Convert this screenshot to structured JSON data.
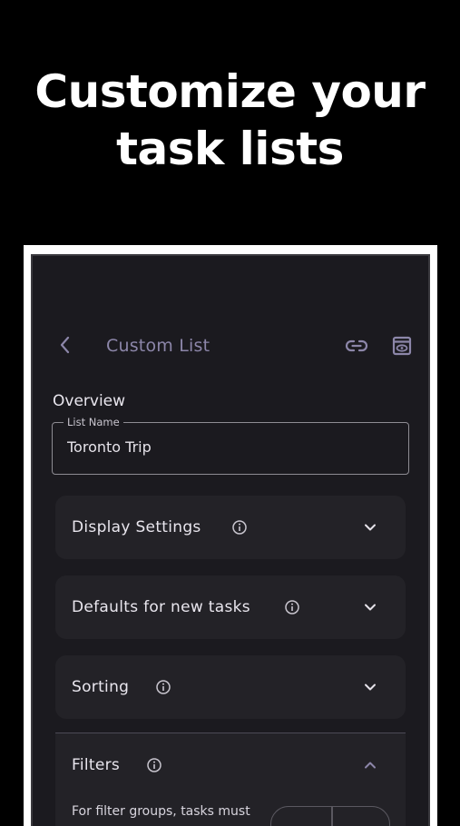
{
  "headline": {
    "line1": "Customize your",
    "line2": "task lists"
  },
  "header": {
    "title": "Custom List",
    "back_icon": "chevron-left-icon",
    "link_icon": "link-icon",
    "preview_icon": "preview-icon"
  },
  "overview": {
    "heading": "Overview",
    "list_name_label": "List Name",
    "list_name_value": "Toronto Trip"
  },
  "sections": {
    "display": {
      "label": "Display Settings"
    },
    "defaults": {
      "label": "Defaults for new tasks"
    },
    "sorting": {
      "label": "Sorting"
    },
    "filters": {
      "label": "Filters",
      "filter_groups_text": "For filter groups, tasks must"
    }
  },
  "colors": {
    "accent": "#8c86a9",
    "background": "#1b1a1f",
    "card": "#232227"
  }
}
